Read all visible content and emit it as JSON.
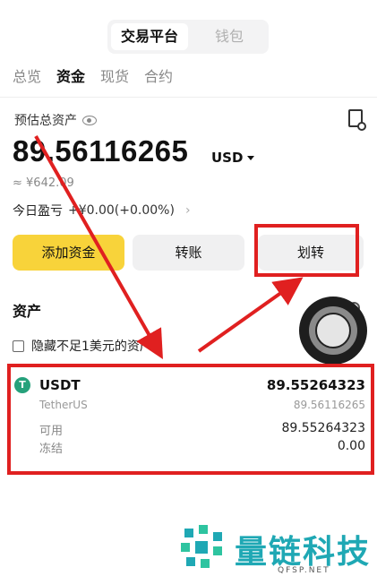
{
  "header": {
    "tabs": [
      {
        "label": "交易平台"
      },
      {
        "label": "钱包"
      }
    ]
  },
  "subtabs": [
    {
      "label": "总览"
    },
    {
      "label": "资金"
    },
    {
      "label": "现货"
    },
    {
      "label": "合约"
    }
  ],
  "summary": {
    "estimated_label": "预估总资产",
    "total": "89.56116265",
    "unit": "USD",
    "approx": "≈ ¥642.09",
    "pnl_label": "今日盈亏",
    "pnl_value": "+¥0.00(+0.00%)"
  },
  "actions": {
    "deposit": "添加资金",
    "transfer": "转账",
    "move": "划转"
  },
  "assets": {
    "title": "资产",
    "hide_small": "隐藏不足1美元的资产",
    "items": [
      {
        "symbol": "USDT",
        "name": "TetherUS",
        "amount": "89.55264323",
        "value_usd": "89.56116265",
        "available_label": "可用",
        "available": "89.55264323",
        "frozen_label": "冻结",
        "frozen": "0.00"
      }
    ]
  },
  "watermark": {
    "text": "量链科技",
    "url": "QFSP.NET"
  },
  "colors": {
    "accent_yellow": "#f8d33a",
    "annotation_red": "#e02020",
    "tether_green": "#26a17b",
    "brand_teal": "#1fa8b4"
  }
}
